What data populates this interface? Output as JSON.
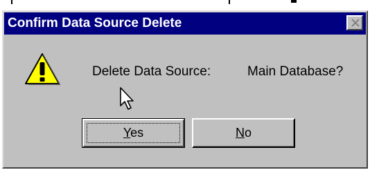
{
  "window": {
    "title": "Confirm Data Source Delete",
    "close_icon": "close-x-icon"
  },
  "message": {
    "label": "Delete Data Source:",
    "value": "Main Database?",
    "icon": "warning-exclamation-icon"
  },
  "buttons": {
    "yes": {
      "mnemonic": "Y",
      "rest": "es",
      "default": true
    },
    "no": {
      "mnemonic": "N",
      "rest": "o",
      "default": false
    }
  },
  "colors": {
    "title_bar": "#000080",
    "dialog_face": "#c0c0c0",
    "warning_yellow": "#ffff00"
  }
}
